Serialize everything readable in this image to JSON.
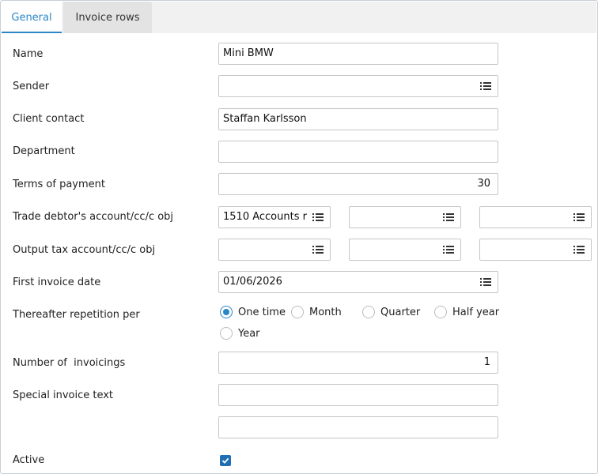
{
  "tabs": [
    {
      "label": "General",
      "active": true
    },
    {
      "label": "Invoice rows",
      "active": false
    }
  ],
  "form": {
    "name": {
      "label": "Name",
      "value": "Mini BMW"
    },
    "sender": {
      "label": "Sender",
      "value": "",
      "icon": "list-icon"
    },
    "client_contact": {
      "label": "Client contact",
      "value": "Staffan Karlsson"
    },
    "department": {
      "label": "Department",
      "value": ""
    },
    "terms_of_payment": {
      "label": "Terms of payment",
      "value": "30"
    },
    "trade_debtor": {
      "label": "Trade debtor's account/cc/c obj",
      "account": "1510 Accounts r",
      "cc": "",
      "c_obj": ""
    },
    "output_tax": {
      "label": "Output tax account/cc/c obj",
      "account": "",
      "cc": "",
      "c_obj": ""
    },
    "first_invoice_date": {
      "label": "First invoice date",
      "value": "01/06/2026"
    },
    "repetition": {
      "label": "Thereafter repetition per",
      "options": [
        "One time",
        "Month",
        "Quarter",
        "Half year",
        "Year"
      ],
      "selected": "One time"
    },
    "number_of_invoicings": {
      "label": "Number of  invoicings",
      "value": "1"
    },
    "special_invoice_text": {
      "label": "Special invoice text",
      "line1": "",
      "line2": ""
    },
    "active": {
      "label": "Active",
      "checked": true
    }
  },
  "colors": {
    "accent": "#2a86c7",
    "checkbox": "#1f6fb2",
    "border": "#c6c6c6",
    "tabbar": "#f1f1f1"
  }
}
